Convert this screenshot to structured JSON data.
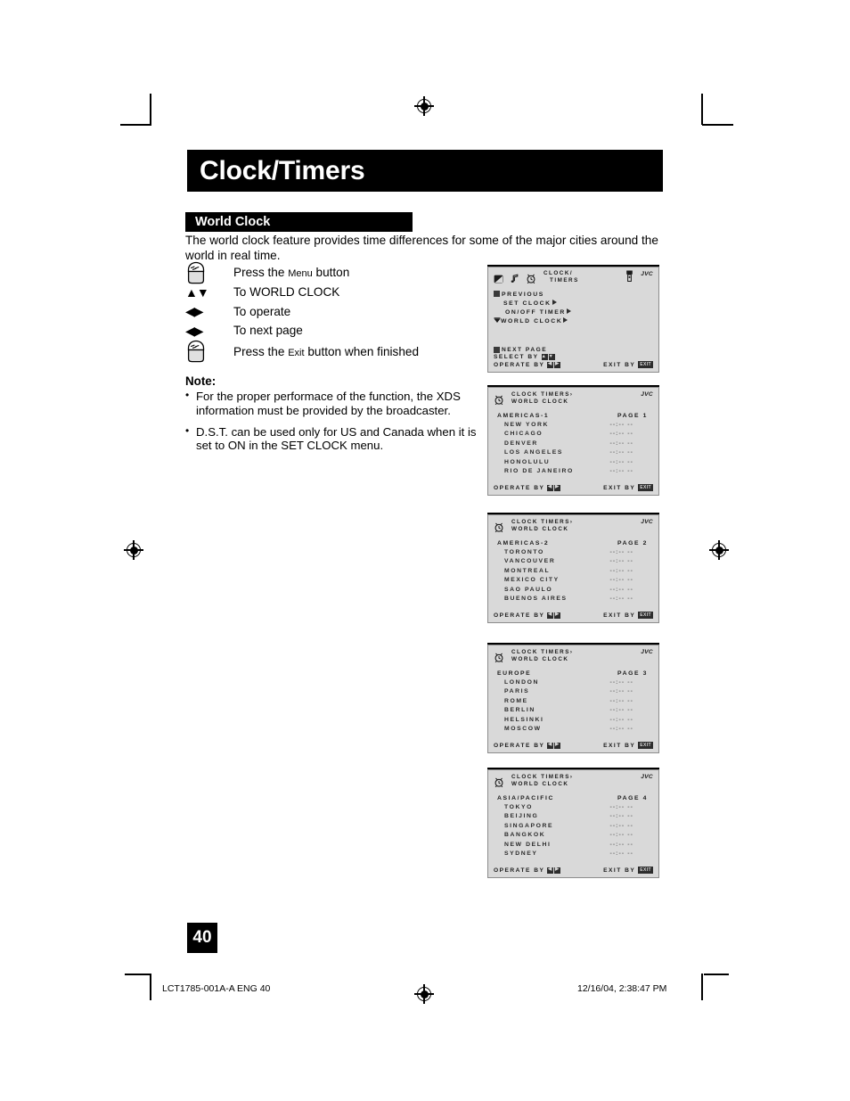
{
  "document": {
    "chapter_title": "Clock/Timers",
    "section_title": "World Clock",
    "intro": "The world clock feature provides time differences for some of the major cities around the world in real time.",
    "page_number": "40",
    "footer_left": "LCT1785-001A-A ENG   40",
    "footer_right": "12/16/04, 2:38:47 PM"
  },
  "steps": [
    {
      "icon": "press-hand-icon",
      "text_before": "Press the ",
      "text_caps": "Menu",
      "text_after": " button"
    },
    {
      "icon": "up-down-arrows-icon",
      "glyph": "▲▼",
      "text": "To WORLD CLOCK"
    },
    {
      "icon": "left-right-arrows-icon",
      "glyph": "◀▶",
      "text": "To operate"
    },
    {
      "icon": "left-right-arrows-icon",
      "glyph": "◀▶",
      "text": "To next page"
    },
    {
      "icon": "press-hand-icon",
      "text_before": "Press the ",
      "text_caps": "Exit",
      "text_after": " button when finished"
    }
  ],
  "note": {
    "heading": "Note:",
    "items": [
      "For the proper performace of the function, the XDS information must be provided by the broadcaster.",
      "D.S.T. can be used only for US and Canada when it is set to ON in the SET CLOCK menu."
    ]
  },
  "osd_main": {
    "title_line1": "CLOCK/",
    "title_line2": "TIMERS",
    "brand": "JVC",
    "menu": [
      {
        "label": "PREVIOUS",
        "marker": "box",
        "arrow": false,
        "indent": false
      },
      {
        "label": "SET CLOCK",
        "marker": "none",
        "arrow": true,
        "indent": true
      },
      {
        "label": "ON/OFF TIMER",
        "marker": "none",
        "arrow": true,
        "indent": true
      },
      {
        "label": "WORLD CLOCK",
        "marker": "cursor",
        "arrow": true,
        "indent": false
      }
    ],
    "next_page": "NEXT PAGE",
    "select_by": "SELECT   BY",
    "operate_by": "OPERATE BY",
    "exit_by": "EXIT BY",
    "exit_key": "EXIT"
  },
  "osd_pages": [
    {
      "title_line1": "CLOCK TIMERS›",
      "title_line2": "WORLD CLOCK",
      "brand": "JVC",
      "region": "AMERICAS-1",
      "page_label": "PAGE 1",
      "cities": [
        {
          "name": "NEW YORK",
          "time": "--:-- --"
        },
        {
          "name": "CHICAGO",
          "time": "--:-- --"
        },
        {
          "name": "DENVER",
          "time": "--:-- --"
        },
        {
          "name": "LOS ANGELES",
          "time": "--:-- --"
        },
        {
          "name": "HONOLULU",
          "time": "--:-- --"
        },
        {
          "name": "RIO DE JANEIRO",
          "time": "--:-- --"
        }
      ],
      "operate_by": "OPERATE BY",
      "exit_by": "EXIT BY",
      "exit_key": "EXIT"
    },
    {
      "title_line1": "CLOCK TIMERS›",
      "title_line2": "WORLD CLOCK",
      "brand": "JVC",
      "region": "AMERICAS-2",
      "page_label": "PAGE 2",
      "cities": [
        {
          "name": "TORONTO",
          "time": "--:-- --"
        },
        {
          "name": "VANCOUVER",
          "time": "--:-- --"
        },
        {
          "name": "MONTREAL",
          "time": "--:-- --"
        },
        {
          "name": "MEXICO CITY",
          "time": "--:-- --"
        },
        {
          "name": "SAO PAULO",
          "time": "--:-- --"
        },
        {
          "name": "BUENOS AIRES",
          "time": "--:-- --"
        }
      ],
      "operate_by": "OPERATE BY",
      "exit_by": "EXIT BY",
      "exit_key": "EXIT"
    },
    {
      "title_line1": "CLOCK TIMERS›",
      "title_line2": "WORLD CLOCK",
      "brand": "JVC",
      "region": "EUROPE",
      "page_label": "PAGE 3",
      "cities": [
        {
          "name": "LONDON",
          "time": "--:-- --"
        },
        {
          "name": "PARIS",
          "time": "--:-- --"
        },
        {
          "name": "ROME",
          "time": "--:-- --"
        },
        {
          "name": "BERLIN",
          "time": "--:-- --"
        },
        {
          "name": "HELSINKI",
          "time": "--:-- --"
        },
        {
          "name": "MOSCOW",
          "time": "--:-- --"
        }
      ],
      "operate_by": "OPERATE BY",
      "exit_by": "EXIT BY",
      "exit_key": "EXIT"
    },
    {
      "title_line1": "CLOCK TIMERS›",
      "title_line2": "WORLD CLOCK",
      "brand": "JVC",
      "region": "ASIA/PACIFIC",
      "page_label": "PAGE 4",
      "cities": [
        {
          "name": "TOKYO",
          "time": "--:-- --"
        },
        {
          "name": "BEIJING",
          "time": "--:-- --"
        },
        {
          "name": "SINGAPORE",
          "time": "--:-- --"
        },
        {
          "name": "BANGKOK",
          "time": "--:-- --"
        },
        {
          "name": "NEW DELHI",
          "time": "--:-- --"
        },
        {
          "name": "SYDNEY",
          "time": "--:-- --"
        }
      ],
      "operate_by": "OPERATE BY",
      "exit_by": "EXIT BY",
      "exit_key": "EXIT"
    }
  ],
  "colors": {
    "banner_bg": "#000000",
    "banner_text": "#ffffff",
    "osd_bg": "#d9d9d9",
    "osd_text": "#1a1a1a"
  }
}
